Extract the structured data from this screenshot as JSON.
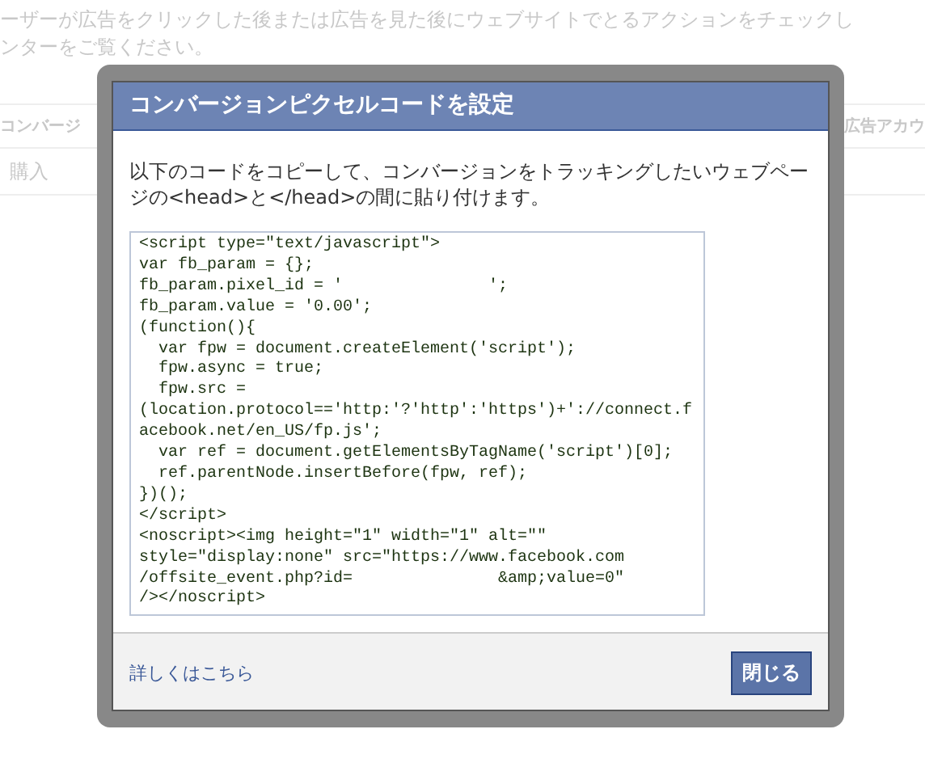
{
  "background": {
    "intro_lines": [
      "ーザーが広告をクリックした後または広告を見た後にウェブサイトでとるアクションをチェックし",
      "ンターをご覧ください。"
    ],
    "table_headers": [
      "コンバージ",
      "広告アカウ"
    ],
    "row_text": "購入"
  },
  "dialog": {
    "title": "コンバージョンピクセルコードを設定",
    "description": "以下のコードをコピーして、コンバージョンをトラッキングしたいウェブページの<head>と</head>の間に貼り付けます。",
    "code": "<script type=\"text/javascript\">\nvar fb_param = {};\nfb_param.pixel_id = '               ';\nfb_param.value = '0.00';\n(function(){\n  var fpw = document.createElement('script');\n  fpw.async = true;\n  fpw.src =\n(location.protocol=='http:'?'http':'https')+'://connect.f\nacebook.net/en_US/fp.js';\n  var ref = document.getElementsByTagName('script')[0];\n  ref.parentNode.insertBefore(fpw, ref);\n})();\n</script>\n<noscript><img height=\"1\" width=\"1\" alt=\"\"\nstyle=\"display:none\" src=\"https://www.facebook.com\n/offsite_event.php?id=               &amp;value=0\"\n/></noscript>",
    "link": "詳しくはこちら",
    "close_button": "閉じる"
  }
}
